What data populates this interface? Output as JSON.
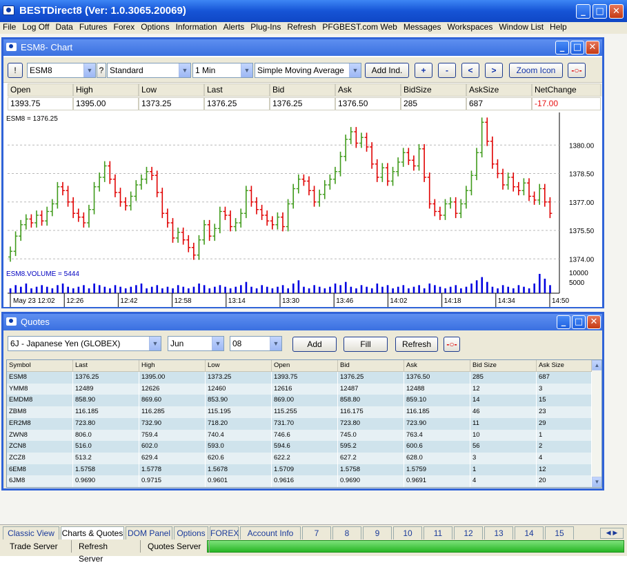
{
  "app": {
    "title": "BESTDirect8 (Ver: 1.0.3065.20069)"
  },
  "menu": [
    "File",
    "Log Off",
    "Data",
    "Futures",
    "Forex",
    "Options",
    "Information",
    "Alerts",
    "Plug-Ins",
    "Refresh",
    "PFGBEST.com Web",
    "Messages",
    "Workspaces",
    "Window List",
    "Help"
  ],
  "chart_window": {
    "title": "ESM8- Chart",
    "alert_button": "!",
    "symbol": "ESM8",
    "help_button": "?",
    "style": "Standard",
    "interval": "1 Min",
    "indicator": "Simple Moving Average",
    "add_ind": "Add Ind.",
    "plus": "+",
    "minus": "-",
    "left": "<",
    "right": ">",
    "zoom": "Zoom Icon",
    "quote_header": [
      "Open",
      "High",
      "Low",
      "Last",
      "Bid",
      "Ask",
      "BidSize",
      "AskSize",
      "NetChange"
    ],
    "quote_values": [
      "1393.75",
      "1395.00",
      "1373.25",
      "1376.25",
      "1376.25",
      "1376.50",
      "285",
      "687",
      "-17.00"
    ],
    "netchange_color": "#e81010"
  },
  "chart_data": {
    "type": "ohlc",
    "title": "ESM8 = 1376.25",
    "volume_label": "ESM8.VOLUME = 5444",
    "y_ticks": [
      "1380.00",
      "1378.50",
      "1377.00",
      "1375.50",
      "1374.00"
    ],
    "y_tick_values": [
      1380.0,
      1378.5,
      1377.0,
      1375.5,
      1374.0
    ],
    "ylim": [
      1373.5,
      1381.5
    ],
    "volume_ticks": [
      "10000",
      "5000"
    ],
    "volume_tick_values": [
      10000,
      5000
    ],
    "x_ticks": [
      "May 23 12:02",
      "12:26",
      "12:42",
      "12:58",
      "13:14",
      "13:30",
      "13:46",
      "14:02",
      "14:18",
      "14:34",
      "14:50"
    ],
    "up_color": "#3f9a1a",
    "down_color": "#e00000",
    "volume_color": "#0000e0",
    "close_series": [
      1374.4,
      1375.2,
      1375.8,
      1376.1,
      1375.9,
      1376.3,
      1376.0,
      1376.5,
      1376.9,
      1377.8,
      1377.6,
      1377.0,
      1376.4,
      1376.2,
      1375.9,
      1376.6,
      1377.8,
      1378.3,
      1378.9,
      1378.2,
      1377.5,
      1377.0,
      1376.8,
      1377.3,
      1377.9,
      1378.2,
      1378.6,
      1378.4,
      1377.5,
      1376.4,
      1375.9,
      1375.1,
      1375.4,
      1375.0,
      1374.6,
      1374.2,
      1375.0,
      1375.8,
      1375.2,
      1375.6,
      1376.5,
      1376.3,
      1375.7,
      1375.9,
      1376.4,
      1377.6,
      1377.0,
      1376.6,
      1376.3,
      1376.0,
      1375.8,
      1376.2,
      1375.7,
      1376.9,
      1377.7,
      1378.2,
      1378.1,
      1377.6,
      1377.0,
      1377.4,
      1377.9,
      1378.2,
      1378.6,
      1379.4,
      1380.3,
      1380.7,
      1380.1,
      1380.4,
      1379.9,
      1379.0,
      1378.3,
      1378.8,
      1378.1,
      1378.6,
      1379.1,
      1379.6,
      1379.2,
      1378.9,
      1379.8,
      1378.3,
      1376.9,
      1376.5,
      1376.3,
      1376.9,
      1377.0,
      1376.4,
      1376.9,
      1377.6,
      1378.4,
      1379.6,
      1381.2,
      1380.2,
      1379.0,
      1378.5,
      1377.9,
      1378.3,
      1377.8,
      1377.6,
      1378.0,
      1377.3,
      1377.1,
      1377.7,
      1377.0,
      1376.4
    ],
    "volume_series": [
      3,
      5,
      4,
      6,
      3,
      4,
      5,
      4,
      3,
      5,
      6,
      4,
      3,
      4,
      5,
      3,
      6,
      5,
      4,
      3,
      5,
      4,
      3,
      4,
      5,
      6,
      3,
      4,
      5,
      3,
      4,
      3,
      5,
      4,
      3,
      4,
      6,
      5,
      3,
      4,
      5,
      4,
      3,
      4,
      5,
      7,
      4,
      3,
      5,
      4,
      3,
      4,
      5,
      3,
      6,
      8,
      4,
      3,
      5,
      4,
      3,
      4,
      6,
      5,
      7,
      4,
      3,
      5,
      4,
      3,
      6,
      4,
      5,
      3,
      4,
      5,
      3,
      4,
      5,
      3,
      6,
      5,
      4,
      3,
      4,
      5,
      3,
      4,
      6,
      8,
      10,
      7,
      4,
      3,
      5,
      4,
      3,
      5,
      4,
      3,
      6,
      12,
      9,
      5
    ]
  },
  "quotes_window": {
    "title": "Quotes",
    "contract": "6J - Japanese Yen (GLOBEX)",
    "month": "Jun",
    "year": "08",
    "add": "Add",
    "fill": "Fill",
    "refresh": "Refresh",
    "columns": [
      "Symbol",
      "Last",
      "High",
      "Low",
      "Open",
      "Bid",
      "Ask",
      "Bid Size",
      "Ask Size"
    ],
    "rows": [
      [
        "ESM8",
        "1376.25",
        "1395.00",
        "1373.25",
        "1393.75",
        "1376.25",
        "1376.50",
        "285",
        "687"
      ],
      [
        "YMM8",
        "12489",
        "12626",
        "12460",
        "12616",
        "12487",
        "12488",
        "12",
        "3"
      ],
      [
        "EMDM8",
        "858.90",
        "869.60",
        "853.90",
        "869.00",
        "858.80",
        "859.10",
        "14",
        "15"
      ],
      [
        "ZBM8",
        "116.185",
        "116.285",
        "115.195",
        "115.255",
        "116.175",
        "116.185",
        "46",
        "23"
      ],
      [
        "ER2M8",
        "723.80",
        "732.90",
        "718.20",
        "731.70",
        "723.80",
        "723.90",
        "11",
        "29"
      ],
      [
        "ZWN8",
        "806.0",
        "759.4",
        "740.4",
        "746.6",
        "745.0",
        "763.4",
        "10",
        "1"
      ],
      [
        "ZCN8",
        "516.0",
        "602.0",
        "593.0",
        "594.6",
        "595.2",
        "600.6",
        "56",
        "2"
      ],
      [
        "ZCZ8",
        "513.2",
        "629.4",
        "620.6",
        "622.2",
        "627.2",
        "628.0",
        "3",
        "4"
      ],
      [
        "6EM8",
        "1.5758",
        "1.5778",
        "1.5678",
        "1.5709",
        "1.5758",
        "1.5759",
        "1",
        "12"
      ],
      [
        "6JM8",
        "0.9690",
        "0.9715",
        "0.9601",
        "0.9616",
        "0.9690",
        "0.9691",
        "4",
        "20"
      ]
    ]
  },
  "tabs": [
    "Classic View",
    "Charts & Quotes",
    "DOM Panel",
    "Options",
    "FOREX",
    "Account Info",
    "7",
    "8",
    "9",
    "10",
    "11",
    "12",
    "13",
    "14",
    "15"
  ],
  "active_tab": "Charts & Quotes",
  "status": [
    "Trade Server",
    "Refresh Server",
    "Quotes Server"
  ]
}
